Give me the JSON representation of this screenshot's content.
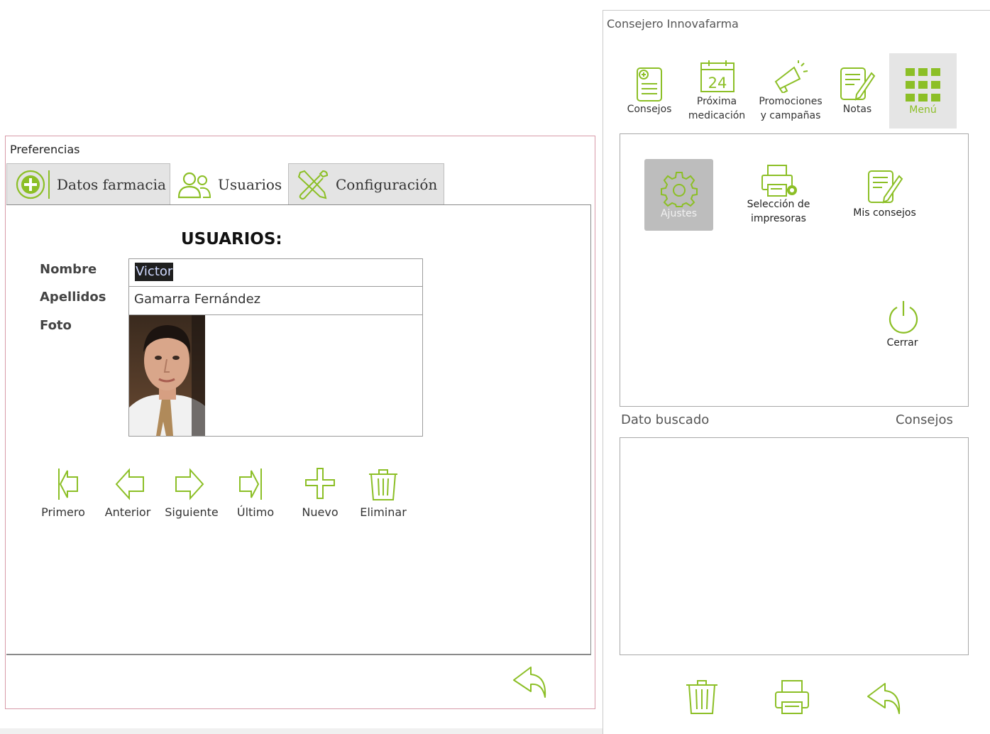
{
  "preferences": {
    "title": "Preferencias",
    "tabs": [
      {
        "label": "Datos farmacia",
        "icon": "plus-circle-icon"
      },
      {
        "label": "Usuarios",
        "icon": "users-icon"
      },
      {
        "label": "Configuración",
        "icon": "tools-icon"
      }
    ],
    "active_tab": "Usuarios",
    "heading": "USUARIOS:",
    "fields": {
      "nombre_label": "Nombre",
      "nombre_value": "Victor",
      "apellidos_label": "Apellidos",
      "apellidos_value": "Gamarra Fernández",
      "foto_label": "Foto"
    },
    "nav_buttons": [
      {
        "label": "Primero",
        "icon": "first-record-icon"
      },
      {
        "label": "Anterior",
        "icon": "previous-arrow-icon"
      },
      {
        "label": "Siguiente",
        "icon": "next-arrow-icon"
      },
      {
        "label": "Último",
        "icon": "last-record-icon"
      },
      {
        "label": "Nuevo",
        "icon": "plus-icon"
      },
      {
        "label": "Eliminar",
        "icon": "trash-icon"
      }
    ],
    "footer_icon": "back-reply-icon"
  },
  "consejero": {
    "title": "Consejero Innovafarma",
    "toolbar": [
      {
        "label": "Consejos",
        "icon": "consejos-document-icon"
      },
      {
        "label_line1": "Próxima",
        "label_line2": "medicación",
        "calendar_day": "24",
        "icon": "calendar-icon"
      },
      {
        "label_line1": "Promociones",
        "label_line2": "y campañas",
        "icon": "megaphone-icon"
      },
      {
        "label": "Notas",
        "icon": "notes-pencil-icon"
      },
      {
        "label": "Menú",
        "icon": "grid-menu-icon"
      }
    ],
    "active_toolbar": "Menú",
    "menu_items": {
      "ajustes": "Ajustes",
      "impresoras_line1": "Selección de",
      "impresoras_line2": "impresoras",
      "mis_consejos": "Mis consejos",
      "cerrar": "Cerrar"
    },
    "dato_buscado_label": "Dato buscado",
    "consejos_label": "Consejos",
    "bottom_icons": [
      "trash-icon",
      "printer-icon",
      "back-reply-icon"
    ]
  },
  "colors": {
    "accent_green": "#8cbf26",
    "window_border": "#d79aa8",
    "selection_bg": "#1f1f1f"
  }
}
